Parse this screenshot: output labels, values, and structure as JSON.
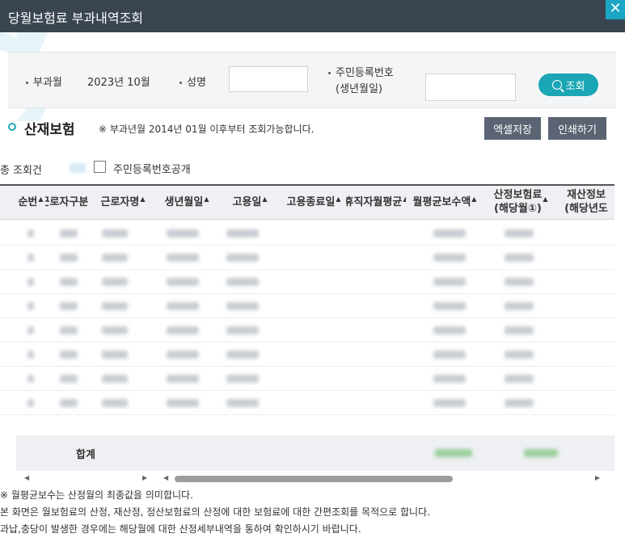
{
  "window": {
    "title": "당월보험료 부과내역조회",
    "close_label": "✕"
  },
  "search": {
    "month_label": "부과월",
    "month_value": "2023년 10월",
    "name_label": "성명",
    "name_value": "",
    "rrn_label_1": "주민등록번호",
    "rrn_label_2": "(생년월일)",
    "rrn_value": "",
    "button_label": "조회"
  },
  "section": {
    "title": "산재보험",
    "note": "※ 부과년월 2014년 01월 이후부터 조회가능합니다.",
    "excel_label": "엑셀저장",
    "print_label": "인쇄하기"
  },
  "summary": {
    "total_label": "총 조회건",
    "checkbox_label": "주민등록번호공개"
  },
  "table": {
    "columns": [
      {
        "label": "순번",
        "sort": true
      },
      {
        "label": "근로자구분",
        "sort": true
      },
      {
        "label": "근로자명",
        "sort": true
      },
      {
        "label": "생년월일",
        "sort": true
      },
      {
        "label": "고용일",
        "sort": true
      },
      {
        "label": "고용종료일",
        "sort": true
      },
      {
        "label": "휴직자월평균",
        "sort": true
      },
      {
        "label": "월평균보수액",
        "sort": true
      },
      {
        "label": "산정보험료\n(해당월①)",
        "sort": true
      },
      {
        "label": "재산정보\n(해당년도",
        "sort": false
      }
    ],
    "row_count": 8,
    "total_label": "합계"
  },
  "notes": [
    "※ 월평균보수는 산정월의 최종값을 의미합니다.",
    "본 화면은 월보험료의 산정, 재산정, 정산보험료의 산정에 대한 보험료에 대한 간편조회를 목적으로 합니다.",
    "과납,충당이 발생한 경우에는 해당월에 대한 산정세부내역을 통하여 확인하시기 바랍니다."
  ],
  "colors": {
    "titlebar": "#3a4552",
    "accent": "#1aa6b4",
    "gray_button": "#5a6472"
  },
  "icons": {
    "close": "close-icon",
    "search": "search-icon",
    "section_bullet": "circle-bullet-icon"
  }
}
